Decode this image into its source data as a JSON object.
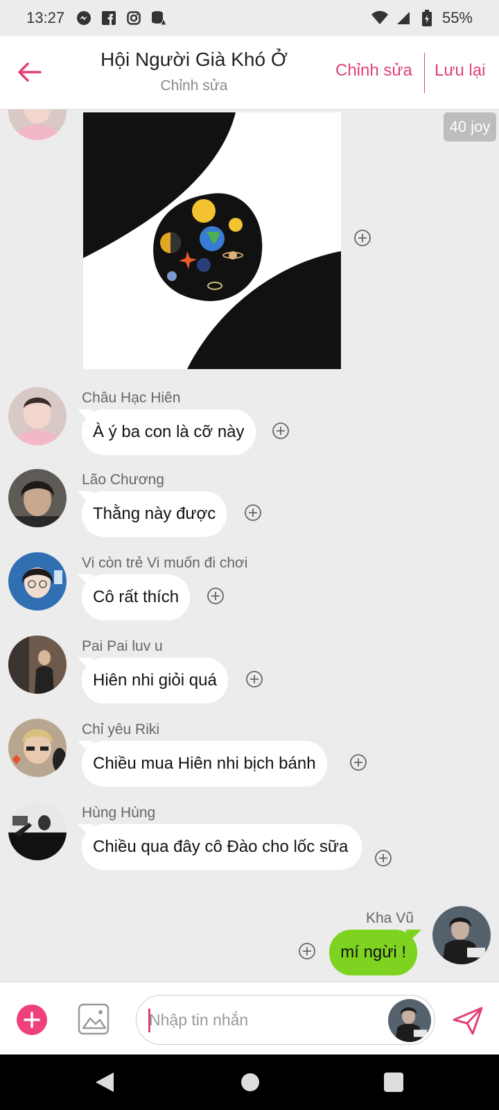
{
  "status_bar": {
    "time": "13:27",
    "notification_icons": [
      "messenger-icon",
      "facebook-icon",
      "instagram-icon",
      "database-alert-icon"
    ],
    "battery": "55%"
  },
  "header": {
    "title": "Hội Người Già Khó Ở",
    "subtitle": "Chỉnh sửa",
    "edit_label": "Chỉnh sửa",
    "save_label": "Lưu lại"
  },
  "chat": {
    "image_message": {
      "reaction_badge": "40 joy"
    },
    "messages": [
      {
        "name": "Châu Hạc Hiên",
        "text": "À ý ba con là cỡ này"
      },
      {
        "name": "Lão Chương",
        "text": "Thằng này được"
      },
      {
        "name": "Vi còn trẻ Vi muốn đi chơi",
        "text": "Cô rất thích"
      },
      {
        "name": "Pai Pai luv u",
        "text": "Hiên nhi giỏi quá"
      },
      {
        "name": "Chỉ yêu Riki",
        "text": "Chiều mua Hiên nhi bịch bánh"
      },
      {
        "name": "Hùng Hùng",
        "text": "Chiều qua đây cô Đào cho lốc sữa"
      }
    ],
    "own_message": {
      "name": "Kha Vũ",
      "text": "mí ngừi !"
    }
  },
  "input": {
    "placeholder": "Nhập tin nhắn"
  },
  "colors": {
    "accent": "#e0407a",
    "own_bubble": "#7ed321",
    "background": "#ececec"
  }
}
